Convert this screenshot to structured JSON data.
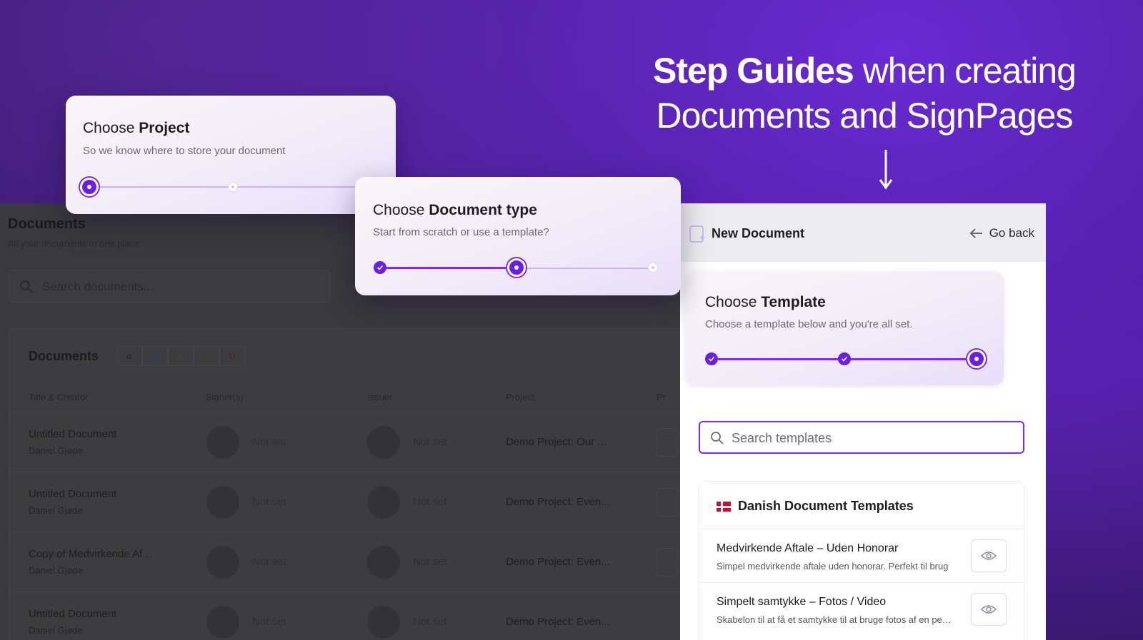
{
  "headline": {
    "bold": "Step Guides",
    "rest_line1": " when creating",
    "line2": "Documents and SignPages"
  },
  "background_app": {
    "page_title": "Documents",
    "page_subtitle": "All your documents in one place",
    "search_placeholder": "Search documents...",
    "table_title": "Documents",
    "badges": [
      {
        "value": "4",
        "color": "#2b2b2e"
      },
      {
        "value": "0",
        "color": "#2a3a78"
      },
      {
        "value": "1",
        "color": "#4a4320"
      },
      {
        "value": "0",
        "color": "#4a3618"
      },
      {
        "value": "0",
        "color": "#4a2020"
      }
    ],
    "columns": [
      "Title & Creator",
      "Signer(s)",
      "Issuer",
      "Project",
      "Pr"
    ],
    "rows": [
      {
        "title": "Untitled Document",
        "creator": "Daniel Gjøde",
        "signer": "Not set",
        "issuer": "Not set",
        "project": "Demo Project: Our ..."
      },
      {
        "title": "Untitled Document",
        "creator": "Daniel Gjøde",
        "signer": "Not set",
        "issuer": "Not set",
        "project": "Demo Project: Even..."
      },
      {
        "title": "Copy of Medvirkende Af...",
        "creator": "Daniel Gjøde",
        "signer": "Not set",
        "issuer": "Not set",
        "project": "Demo Project: Even..."
      },
      {
        "title": "Untitled Document",
        "creator": "Daniel Gjøde",
        "signer": "Not set",
        "issuer": "Not set",
        "project": "Demo Project: Even..."
      }
    ]
  },
  "step_project": {
    "title_prefix": "Choose ",
    "title_bold": "Project",
    "subtitle": "So we know where to store your document"
  },
  "step_doctype": {
    "title_prefix": "Choose ",
    "title_bold": "Document type",
    "subtitle": "Start from scratch or use a template?"
  },
  "panel": {
    "title": "New Document",
    "go_back": "Go back",
    "step_template": {
      "title_prefix": "Choose ",
      "title_bold": "Template",
      "subtitle": "Choose a template below and you're all set."
    },
    "search_placeholder": "Search templates",
    "group_title": "Danish Document Templates",
    "templates": [
      {
        "name": "Medvirkende Aftale – Uden Honorar",
        "description": "Simpel medvirkende aftale uden honorar. Perfekt til brug"
      },
      {
        "name": "Simpelt samtykke – Fotos / Video",
        "description": "Skabelon til at få et samtykke til at bruge fotos af en person"
      }
    ]
  },
  "colors": {
    "accent": "#7b2cf0",
    "accent_dark": "#6b1fe0"
  }
}
